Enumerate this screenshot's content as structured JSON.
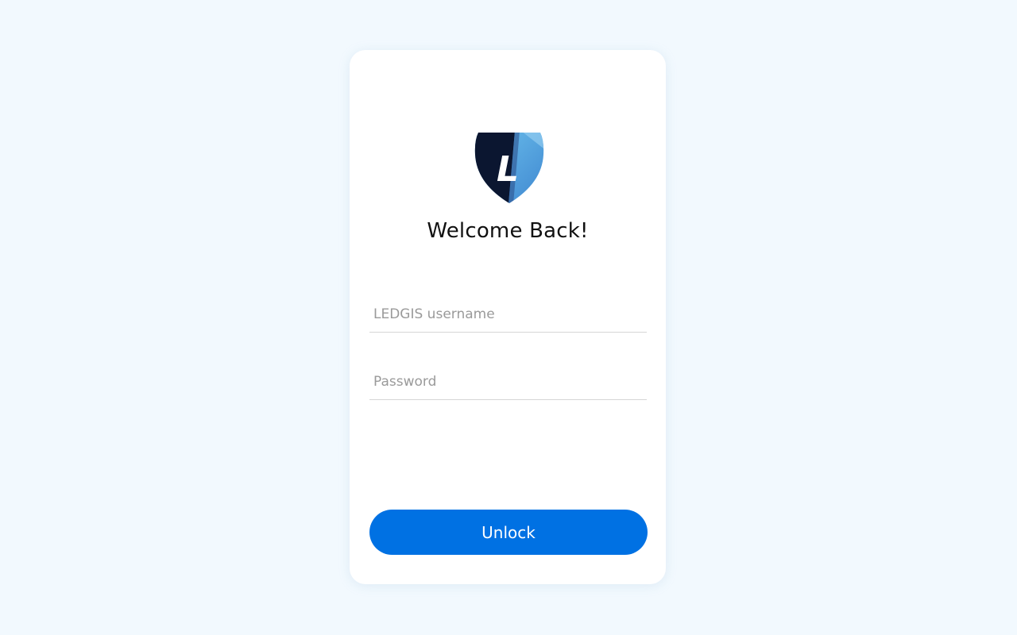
{
  "brand": {
    "logo_icon": "ledgis-shield-logo",
    "logo_letter": "L",
    "colors": {
      "shield_dark": "#0b1630",
      "shield_light": "#5fb4e8"
    }
  },
  "login": {
    "title": "Welcome Back!",
    "username_placeholder": "LEDGIS username",
    "username_value": "",
    "password_placeholder": "Password",
    "password_value": "",
    "unlock_label": "Unlock"
  },
  "colors": {
    "background": "#f2f9fe",
    "card": "#ffffff",
    "accent": "#0071e3"
  }
}
